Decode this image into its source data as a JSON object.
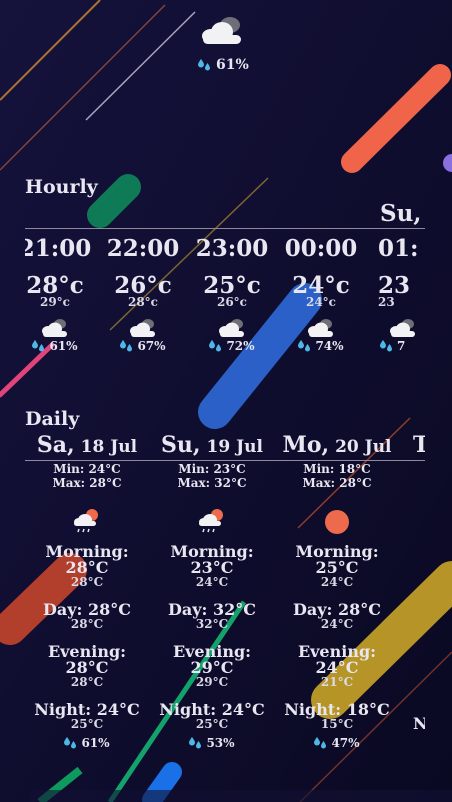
{
  "top": {
    "humidity": "61%"
  },
  "hourly": {
    "title": "Hourly",
    "day_label": "Su,",
    "items": [
      {
        "time": "21:00",
        "temp": "28°c",
        "feels": "29°c",
        "humidity": "61%"
      },
      {
        "time": "22:00",
        "temp": "26°c",
        "feels": "28°c",
        "humidity": "67%"
      },
      {
        "time": "23:00",
        "temp": "25°c",
        "feels": "26°c",
        "humidity": "72%"
      },
      {
        "time": "00:00",
        "temp": "24°c",
        "feels": "24°c",
        "humidity": "74%"
      },
      {
        "time": "01:",
        "temp": "23",
        "feels": "23",
        "humidity": "7"
      }
    ]
  },
  "daily": {
    "title": "Daily",
    "items": [
      {
        "day": "Sa,",
        "date": " 18 Jul",
        "min": "Min: 24°C",
        "max": "Max: 28°C",
        "icon": "cloud-sun-rain-icon",
        "morning_label": "Morning:",
        "morning_temp": "28°C",
        "morning_feel": "28°C",
        "day_part": "Day: 28°C",
        "day_feel": "28°C",
        "evening_label": "Evening:",
        "evening_temp": "28°C",
        "evening_feel": "28°C",
        "night_part": "Night: 24°C",
        "night_feel": "25°C",
        "humidity": "61%"
      },
      {
        "day": "Su,",
        "date": " 19 Jul",
        "min": "Min: 23°C",
        "max": "Max: 32°C",
        "icon": "cloud-sun-rain-icon",
        "morning_label": "Morning:",
        "morning_temp": "23°C",
        "morning_feel": "24°C",
        "day_part": "Day: 32°C",
        "day_feel": "32°C",
        "evening_label": "Evening:",
        "evening_temp": "29°C",
        "evening_feel": "29°C",
        "night_part": "Night: 24°C",
        "night_feel": "25°C",
        "humidity": "53%"
      },
      {
        "day": "Mo,",
        "date": " 20 Jul",
        "min": "Min: 18°C",
        "max": "Max: 28°C",
        "icon": "sun-icon",
        "morning_label": "Morning:",
        "morning_temp": "25°C",
        "morning_feel": "24°C",
        "day_part": "Day: 28°C",
        "day_feel": "24°C",
        "evening_label": "Evening:",
        "evening_temp": "24°C",
        "evening_feel": "21°C",
        "night_part": "Night: 18°C",
        "night_feel": "15°C",
        "humidity": "47%"
      },
      {
        "day": "T",
        "date": "",
        "min": "",
        "max": "",
        "icon": "",
        "morning_label": "",
        "morning_temp": "",
        "morning_feel": "",
        "day_part": "",
        "day_feel": "",
        "evening_label": "",
        "evening_temp": "",
        "evening_feel": "",
        "night_part": "N",
        "night_feel": "",
        "humidity": ""
      }
    ]
  },
  "colors": {
    "background": "#0b0a26",
    "text": "#e8e6f0",
    "humidity_drop": "#4fb6e8",
    "sun": "#ee6a4d"
  }
}
